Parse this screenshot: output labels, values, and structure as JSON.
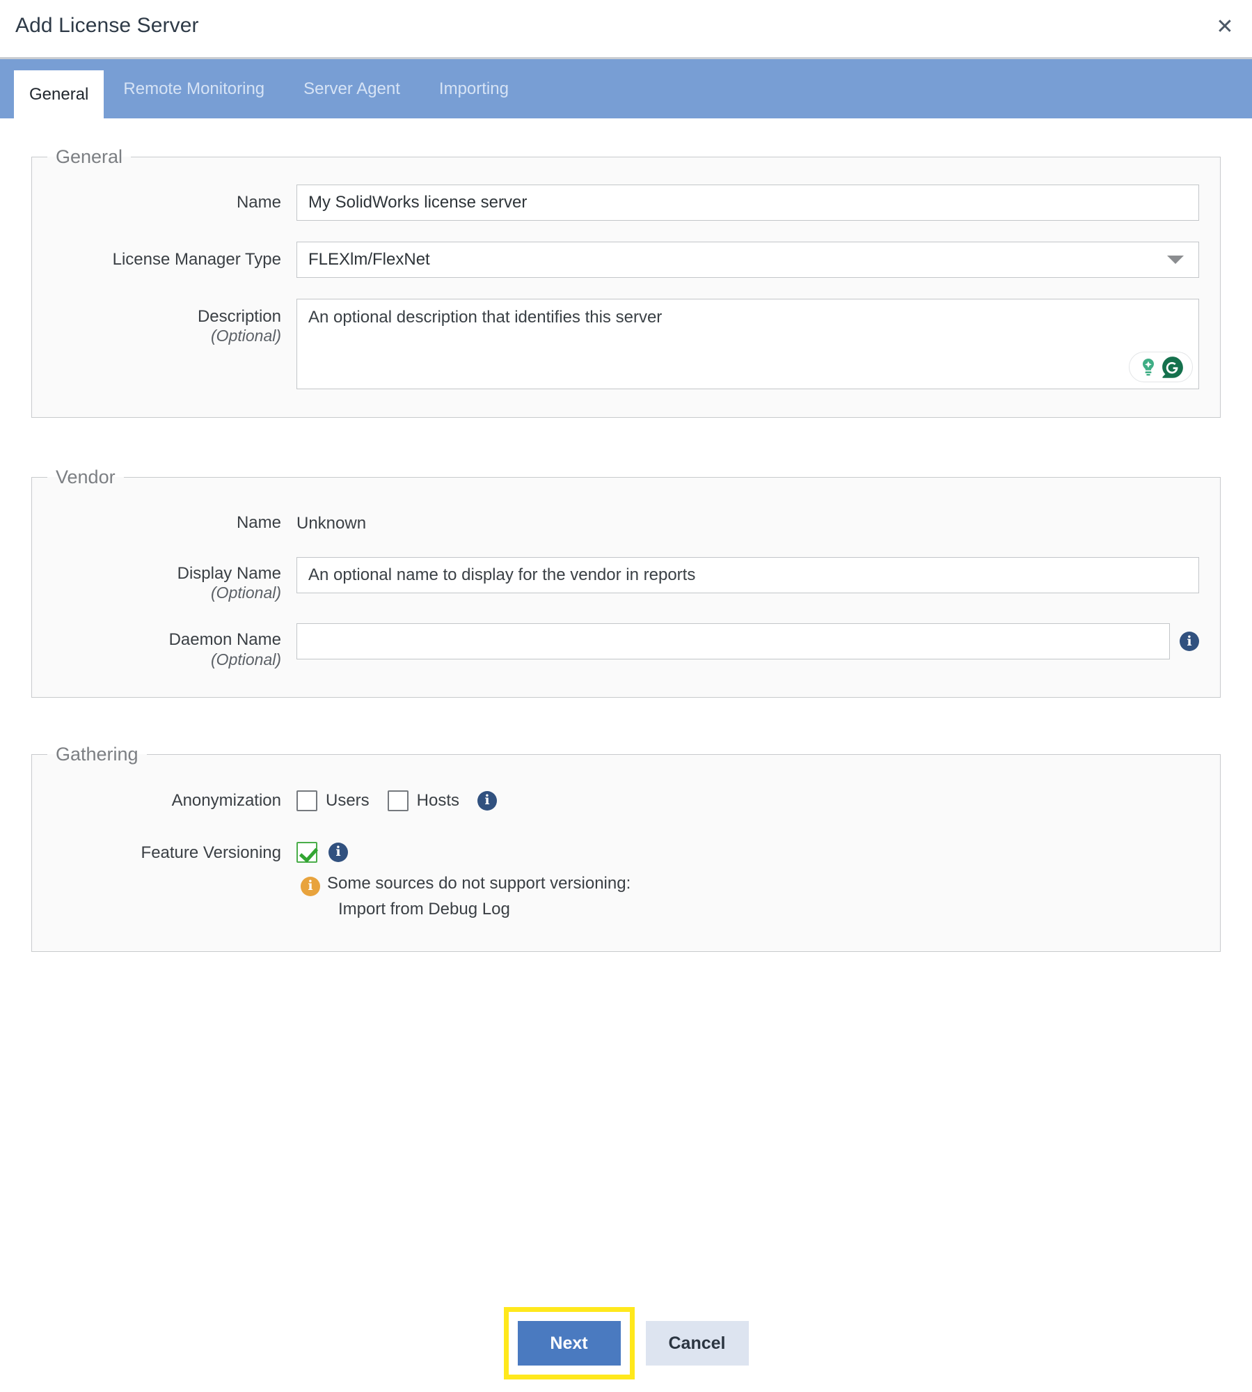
{
  "dialog": {
    "title": "Add License Server",
    "close_label": "✕",
    "close_icon": "close-icon"
  },
  "tabs": [
    {
      "label": "General",
      "active": true
    },
    {
      "label": "Remote Monitoring",
      "active": false
    },
    {
      "label": "Server Agent",
      "active": false
    },
    {
      "label": "Importing",
      "active": false
    }
  ],
  "general": {
    "legend": "General",
    "name_label": "Name",
    "name_value": "My SolidWorks license server",
    "license_manager_label": "License Manager Type",
    "license_manager_value": "FLEXlm/FlexNet",
    "license_manager_options": [
      "FLEXlm/FlexNet"
    ],
    "description_label": "Description",
    "description_optional": "(Optional)",
    "description_placeholder": "An optional description that identifies this server",
    "description_value": "",
    "grammarly_icon": "grammarly-logo-icon",
    "grammarly_assistant_icon": "lightbulb-sparkle-icon"
  },
  "vendor": {
    "legend": "Vendor",
    "name_label": "Name",
    "name_value": "Unknown",
    "display_name_label": "Display Name",
    "display_name_optional": "(Optional)",
    "display_name_placeholder": "An optional name to display for the vendor in reports",
    "display_name_value": "",
    "daemon_name_label": "Daemon Name",
    "daemon_name_optional": "(Optional)",
    "daemon_name_value": "",
    "daemon_info_icon": "info-icon",
    "info_glyph": "i"
  },
  "gathering": {
    "legend": "Gathering",
    "anonymization_label": "Anonymization",
    "users_label": "Users",
    "users_checked": false,
    "hosts_label": "Hosts",
    "hosts_checked": false,
    "anonymization_info_icon": "info-icon",
    "feature_versioning_label": "Feature Versioning",
    "feature_versioning_checked": true,
    "feature_versioning_info_icon": "info-icon",
    "warning_icon": "warning-info-icon",
    "warning_line1": "Some sources do not support versioning:",
    "warning_line2": "Import from Debug Log",
    "info_glyph": "i"
  },
  "footer": {
    "next_label": "Next",
    "cancel_label": "Cancel"
  },
  "colors": {
    "tabbar_blue": "#789ed4",
    "primary_button": "#4a7ac0",
    "cancel_button": "#dde4f0",
    "highlight_ring": "#ffe81c",
    "info_blue": "#31517f",
    "warning_orange": "#e8a33d",
    "check_green": "#32a532",
    "grammarly_green": "#15714d"
  }
}
